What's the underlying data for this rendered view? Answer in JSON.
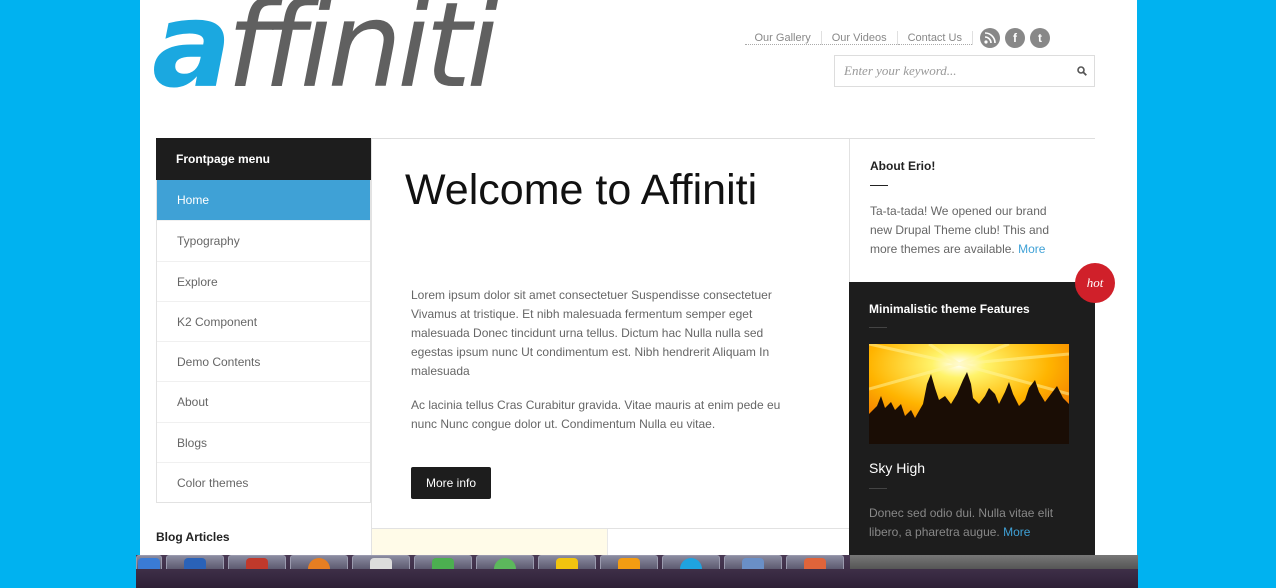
{
  "site": {
    "logo_accent": "a",
    "logo_rest": "ffiniti"
  },
  "top_links": [
    "Our Gallery",
    "Our Videos",
    "Contact Us"
  ],
  "social_icons": [
    "rss-icon",
    "facebook-icon",
    "twitter-icon"
  ],
  "search": {
    "placeholder": "Enter your keyword..."
  },
  "sidebar": {
    "title": "Frontpage menu",
    "items": [
      {
        "label": "Home",
        "active": true
      },
      {
        "label": "Typography"
      },
      {
        "label": "Explore"
      },
      {
        "label": "K2 Component"
      },
      {
        "label": "Demo Contents"
      },
      {
        "label": "About"
      },
      {
        "label": "Blogs"
      },
      {
        "label": "Color themes"
      }
    ],
    "blog_title": "Blog Articles"
  },
  "main": {
    "title": "Welcome to Affiniti",
    "para1": "Lorem ipsum dolor sit amet consectetuer Suspendisse consectetuer Vivamus at tristique. Et nibh malesuada fermentum semper eget malesuada Donec tincidunt urna tellus. Dictum hac Nulla nulla sed egestas ipsum nunc Ut condimentum est. Nibh hendrerit Aliquam In malesuada",
    "para2": "Ac lacinia tellus Cras Curabitur gravida. Vitae mauris at enim pede eu nunc Nunc congue dolor ut. Condimentum Nulla eu vitae.",
    "button": "More info"
  },
  "about": {
    "title": "About Erio!",
    "text": "Ta-ta-tada! We opened our brand new Drupal Theme club! This and more themes are available.",
    "link": "More"
  },
  "features": {
    "badge": "hot",
    "title": "Minimalistic theme Features",
    "item_title": "Sky High",
    "text": "Donec sed odio dui. Nulla vitae elit libero, a pharetra augue.",
    "link": "More"
  },
  "colors": {
    "background": "#00b2f0",
    "accent": "#3fa1d6",
    "dark": "#1d1d1d",
    "hot": "#d0202a"
  }
}
